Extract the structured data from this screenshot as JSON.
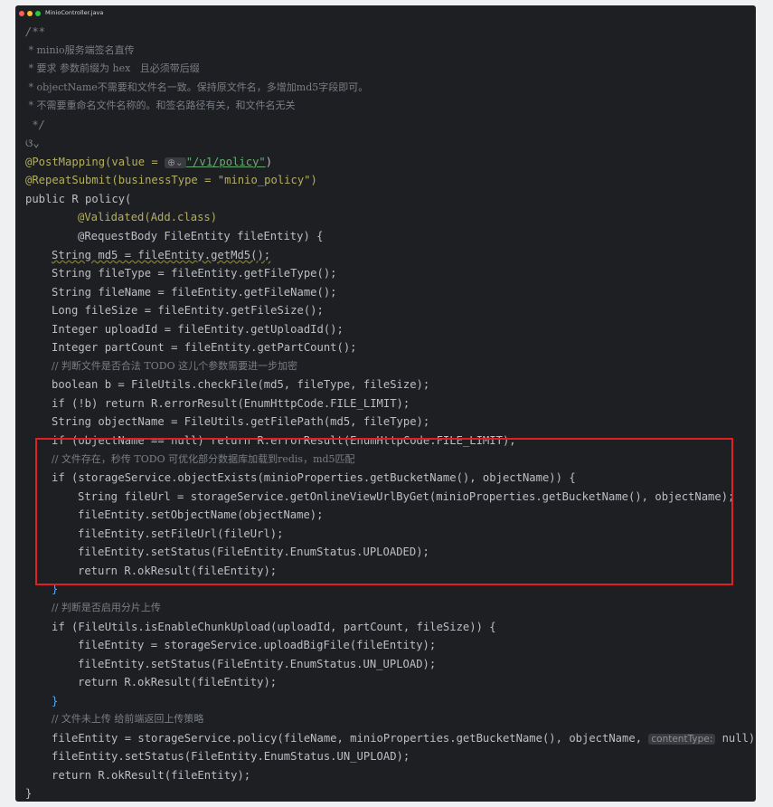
{
  "window": {
    "title": "MinioController.java"
  },
  "code": {
    "lines": [
      "/**",
      " * minio服务端签名直传",
      " * 要求 参数前缀为 hex   且必须带后缀",
      " * objectName不需要和文件名一致。保持原文件名，多增加md5字段即可。",
      " * 不需要重命名文件名称的。和签名路径有关，和文件名无关",
      " */",
      "ଓ⌄",
      "@PostMapping(value = ",
      "\"/v1/policy\"",
      ")",
      "@RepeatSubmit(businessType = \"minio_policy\")",
      "public R policy(",
      "@Validated(Add.class)",
      "@RequestBody FileEntity fileEntity) {",
      "String md5 = fileEntity.getMd5();",
      "String fileType = fileEntity.getFileType();",
      "String fileName = fileEntity.getFileName();",
      "Long fileSize = fileEntity.getFileSize();",
      "Integer uploadId = fileEntity.getUploadId();",
      "Integer partCount = fileEntity.getPartCount();",
      "// 判断文件是否合法 TODO 这儿个参数需要进一步加密",
      "boolean b = FileUtils.checkFile(md5, fileType, fileSize);",
      "if (!b) return R.errorResult(EnumHttpCode.FILE_LIMIT);",
      "String objectName = FileUtils.getFilePath(md5, fileType);",
      "if (objectName == null) return R.errorResult(EnumHttpCode.FILE_LIMIT);",
      "// 文件存在，秒传 TODO 可优化部分数据库加载到redis，md5匹配",
      "if (storageService.objectExists(minioProperties.getBucketName(), objectName)) {",
      "String fileUrl = storageService.getOnlineViewUrlByGet(minioProperties.getBucketName(), objectName);",
      "fileEntity.setObjectName(objectName);",
      "fileEntity.setFileUrl(fileUrl);",
      "fileEntity.setStatus(FileEntity.EnumStatus.UPLOADED);",
      "return R.okResult(fileEntity);",
      "}",
      "// 判断是否启用分片上传",
      "if (FileUtils.isEnableChunkUpload(uploadId, partCount, fileSize)) {",
      "fileEntity = storageService.uploadBigFile(fileEntity);",
      "fileEntity.setStatus(FileEntity.EnumStatus.UN_UPLOAD);",
      "return R.okResult(fileEntity);",
      "}",
      "// 文件未上传 给前端返回上传策略",
      "fileEntity = storageService.policy(fileName, minioProperties.getBucketName(), objectName, ",
      "contentType:",
      " null);",
      "fileEntity.setStatus(FileEntity.EnumStatus.UN_UPLOAD);",
      "return R.okResult(fileEntity);",
      "}"
    ]
  }
}
